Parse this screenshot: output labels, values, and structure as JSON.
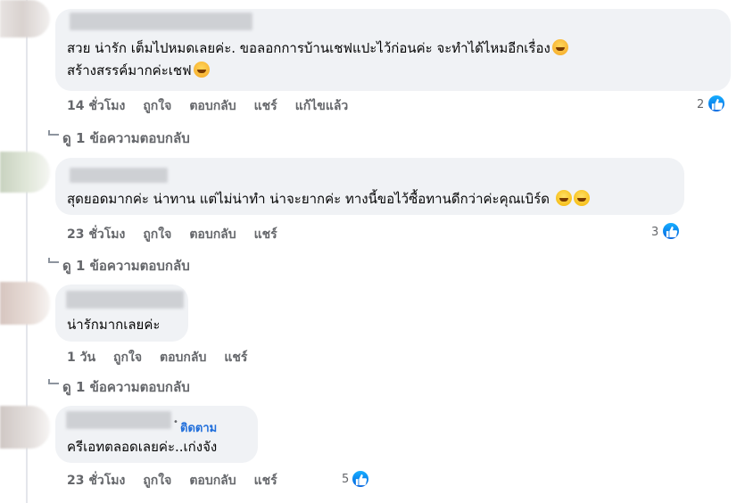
{
  "colors": {
    "bubble": "#f0f2f5",
    "meta_text": "#65676b",
    "link_blue": "#216fdb",
    "like_blue": "#0866ff"
  },
  "comments": [
    {
      "line1": "สวย น่ารัก เต็มไปหมดเลยค่ะ. ขอลอกการบ้านเชฟแปะไว้ก่อนค่ะ จะทำได้ไหมอีกเรื่อง",
      "line2": "สร้างสรรค์มากค่ะเชฟ",
      "line1_emoji": "rolling-laughing-emoji",
      "line2_emoji": "smiling-hearts-emoji",
      "time": "14 ชั่วโมง",
      "like": "ถูกใจ",
      "reply": "ตอบกลับ",
      "share": "แชร์",
      "edited": "แก้ไขแล้ว",
      "reactions": "2",
      "view_replies": "ดู 1 ข้อความตอบกลับ"
    },
    {
      "line1": "สุดยอดมากค่ะ น่าทาน แต่ไม่น่าทำ น่าจะยากค่ะ ทางนี้ขอไว้ซื้อทานดีกว่าค่ะคุณเบิร์ด",
      "line1_emoji": "grinning-emoji",
      "time": "23 ชั่วโมง",
      "like": "ถูกใจ",
      "reply": "ตอบกลับ",
      "share": "แชร์",
      "reactions": "3",
      "view_replies": "ดู 1 ข้อความตอบกลับ"
    },
    {
      "line1": "น่ารักมากเลยค่ะ",
      "time": "1 วัน",
      "like": "ถูกใจ",
      "reply": "ตอบกลับ",
      "share": "แชร์",
      "view_replies": "ดู 1 ข้อความตอบกลับ"
    },
    {
      "follow": "ติดตาม",
      "line1": "ครีเอทตลอดเลยค่ะ..เก่งจัง",
      "time": "23 ชั่วโมง",
      "like": "ถูกใจ",
      "reply": "ตอบกลับ",
      "share": "แชร์",
      "reactions": "5"
    }
  ]
}
